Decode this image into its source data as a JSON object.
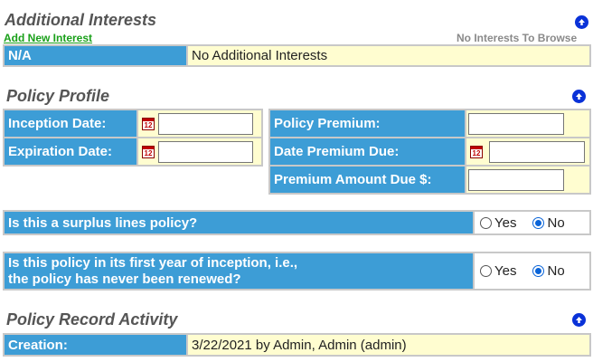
{
  "additional_interests": {
    "title": "Additional Interests",
    "add_link": "Add New Interest",
    "browse_note": "No Interests To Browse",
    "row_label": "N/A",
    "row_value": "No Additional Interests"
  },
  "policy_profile": {
    "title": "Policy Profile",
    "inception_label": "Inception Date:",
    "inception_value": "",
    "expiration_label": "Expiration Date:",
    "expiration_value": "",
    "premium_label": "Policy Premium:",
    "premium_value": "",
    "date_due_label": "Date Premium Due:",
    "date_due_value": "",
    "amount_due_label": "Premium Amount Due $:",
    "amount_due_value": "",
    "calendar_icon_text": "12"
  },
  "surplus": {
    "question": "Is this a surplus lines policy?",
    "yes_label": "Yes",
    "no_label": "No",
    "selected": "No"
  },
  "first_year": {
    "question_line1": "Is this policy in its first year of inception, i.e.,",
    "question_line2": "the policy has never been renewed?",
    "yes_label": "Yes",
    "no_label": "No",
    "selected": "No"
  },
  "record_activity": {
    "title": "Policy Record Activity",
    "creation_label": "Creation:",
    "creation_value": "3/22/2021 by Admin, Admin (admin)"
  },
  "colors": {
    "label_bg": "#3d9dd6",
    "value_bg": "#fffdd0",
    "link_green": "#1aa01a",
    "up_icon_blue": "#0a32d8"
  }
}
